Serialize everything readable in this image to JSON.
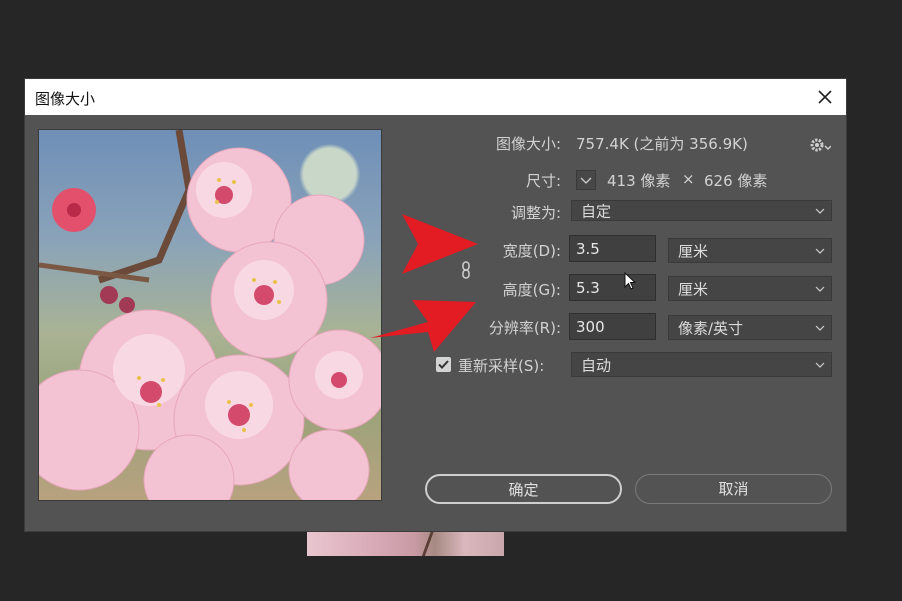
{
  "dialog": {
    "title": "图像大小",
    "close_icon": "close-icon"
  },
  "info": {
    "image_size_label": "图像大小:",
    "image_size_value": "757.4K (之前为 356.9K)",
    "dimensions_label": "尺寸:",
    "width_px": "413 像素",
    "times": "×",
    "height_px": "626 像素",
    "settings_icon": "gear-icon"
  },
  "form": {
    "fit_to_label": "调整为:",
    "fit_to_value": "自定",
    "width_label": "宽度(D):",
    "width_value": "3.5",
    "width_unit": "厘米",
    "height_label": "高度(G):",
    "height_value": "5.3",
    "height_unit": "厘米",
    "resolution_label": "分辨率(R):",
    "resolution_value": "300",
    "resolution_unit": "像素/英寸",
    "resample_label": "重新采样(S):",
    "resample_checked": true,
    "resample_value": "自动"
  },
  "buttons": {
    "ok": "确定",
    "cancel": "取消"
  },
  "colors": {
    "dialog_bg": "#535353",
    "annotation_arrow": "#e31b23"
  }
}
